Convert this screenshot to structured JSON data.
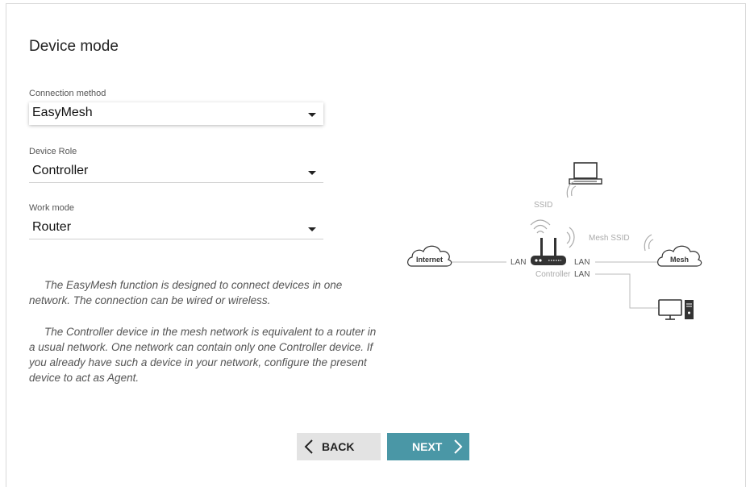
{
  "page": {
    "title": "Device mode"
  },
  "fields": {
    "connection_method": {
      "label": "Connection method",
      "value": "EasyMesh"
    },
    "device_role": {
      "label": "Device Role",
      "value": "Controller"
    },
    "work_mode": {
      "label": "Work mode",
      "value": "Router"
    }
  },
  "description": {
    "paragraph1": "The EasyMesh function is designed to connect devices in one network. The connection can be wired or wireless.",
    "paragraph2": "The Controller device in the mesh network is equivalent to a router in a usual network. One network can contain only one Controller device. If you already have such a device in your network, configure the present device to act as Agent."
  },
  "diagram": {
    "internet": "Internet",
    "mesh": "Mesh",
    "ssid": "SSID",
    "mesh_ssid": "Mesh SSID",
    "lan_left": "LAN",
    "lan_right": "LAN",
    "controller": "Controller",
    "lan_bottom": "LAN"
  },
  "buttons": {
    "back": "BACK",
    "next": "NEXT"
  },
  "colors": {
    "next_button_bg": "#4a97a6",
    "back_button_bg": "#e3e3e3",
    "diagram_line": "#bbbbbb"
  }
}
